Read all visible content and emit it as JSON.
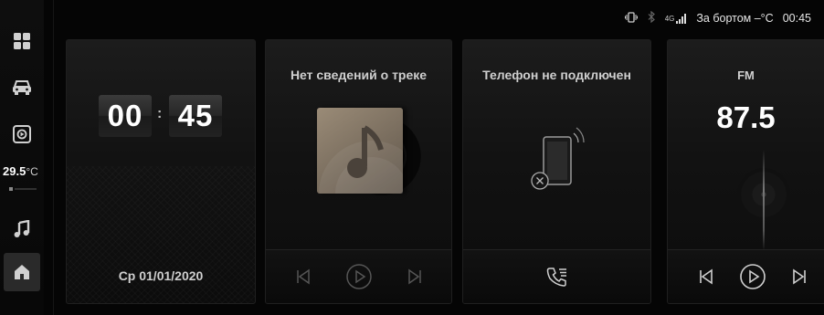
{
  "sidebar": {
    "items": [
      {
        "icon": "apps-grid-icon"
      },
      {
        "icon": "car-icon"
      },
      {
        "icon": "media-player-icon"
      },
      {
        "icon": "music-note-icon"
      },
      {
        "icon": "home-icon",
        "active": true
      }
    ],
    "temperature": {
      "value": "29.5",
      "unit": "°C"
    }
  },
  "status_bar": {
    "icons": [
      "vibrate-icon",
      "bluetooth-icon"
    ],
    "network": "4G",
    "outside_temp": "За бортом –°C",
    "time": "00:45"
  },
  "clock_card": {
    "hours": "00",
    "minutes": "45",
    "separator": ":",
    "date": "Ср  01/01/2020"
  },
  "music_card": {
    "title": "Нет сведений о треке",
    "controls": [
      "previous-icon",
      "play-icon",
      "next-icon"
    ]
  },
  "phone_card": {
    "title": "Телефон не подключен",
    "footer_icon": "call-log-icon"
  },
  "radio_card": {
    "band": "FM",
    "frequency": "87.5",
    "controls": [
      "previous-icon",
      "play-icon",
      "next-icon"
    ]
  },
  "colors": {
    "background": "#050505",
    "card": "#151515",
    "text": "#d8d8d8",
    "accent_white": "#ffffff"
  }
}
